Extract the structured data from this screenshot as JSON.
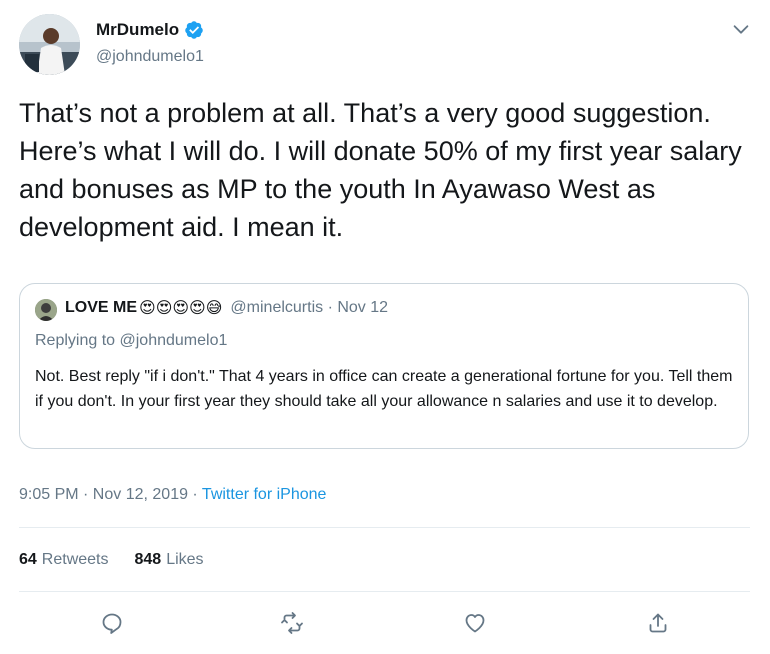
{
  "tweet": {
    "display_name": "MrDumelo",
    "handle": "@johndumelo1",
    "verified": true,
    "text": "That’s not a problem at all. That’s a very good suggestion. Here’s what I will do. I will donate 50% of my first year salary and bonuses as MP to the youth In Ayawaso West as development aid. I mean it."
  },
  "quote": {
    "display_name": "LOVE ME",
    "emojis": "😍😍😍😍😅",
    "handle_and_date": "@minelcurtis · Nov 12",
    "replying_prefix": "Replying to ",
    "replying_to": "@johndumelo1",
    "text": "Not. Best reply \"if i don't.\" That 4 years in office can create a generational fortune for you. Tell them if you don't. In your first year they should take all your allowance n salaries and use it to develop."
  },
  "meta": {
    "time_date": "9:05 PM · Nov 12, 2019 · ",
    "source": "Twitter for iPhone"
  },
  "stats": {
    "retweets_count": "64",
    "retweets_label": "Retweets",
    "likes_count": "848",
    "likes_label": "Likes"
  },
  "icons": {
    "reply": "reply-icon",
    "retweet": "retweet-icon",
    "like": "heart-icon",
    "share": "share-icon",
    "more": "chevron-down-icon",
    "verified": "verified-badge-icon"
  },
  "colors": {
    "primary_text": "#14171a",
    "secondary_text": "#657786",
    "link": "#1b95e0",
    "verified": "#1da1f2",
    "border": "#ccd6dd"
  }
}
